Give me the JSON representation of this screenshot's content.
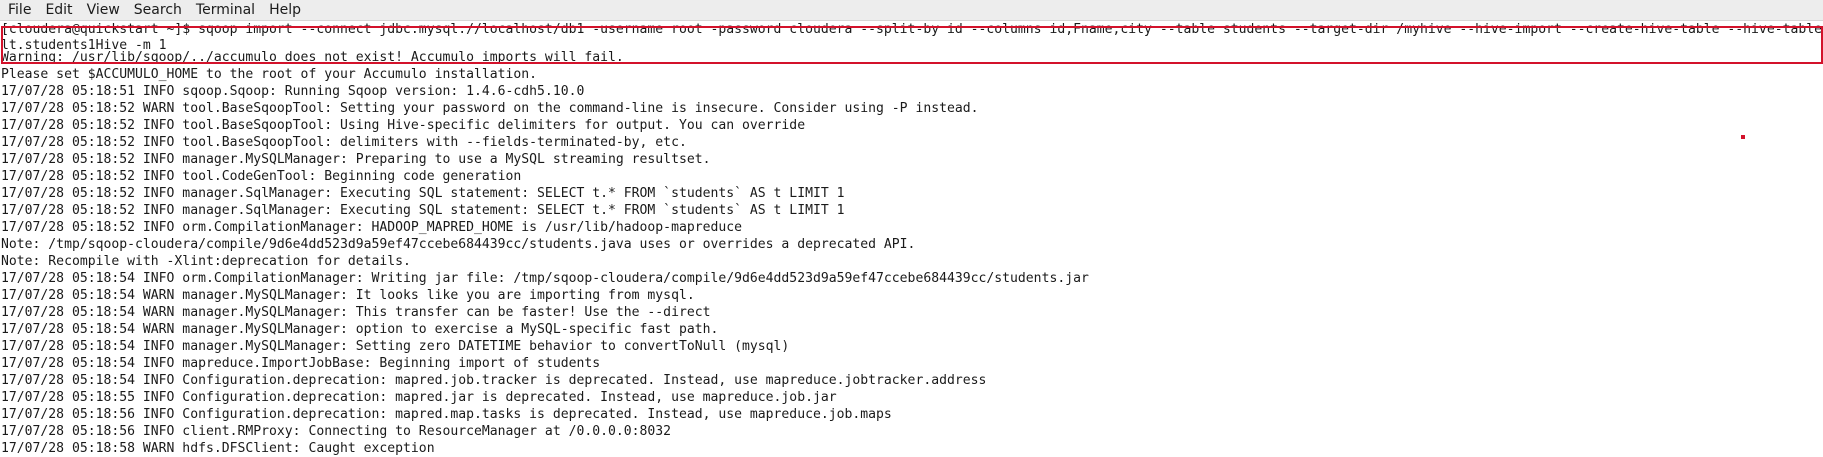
{
  "menu": [
    "File",
    "Edit",
    "View",
    "Search",
    "Terminal",
    "Help"
  ],
  "terminal": {
    "lines": [
      "[cloudera@quickstart ~]$ sqoop import --connect jdbc:mysql://localhost/db1 -username root -password cloudera --split-by id --columns id,Fname,city --table students --target-dir /myhive --hive-import --create-hive-table --hive-table",
      "lt.students1Hive -m 1",
      "Warning: /usr/lib/sqoop/../accumulo does not exist! Accumulo imports will fail.",
      "Please set $ACCUMULO_HOME to the root of your Accumulo installation.",
      "17/07/28 05:18:51 INFO sqoop.Sqoop: Running Sqoop version: 1.4.6-cdh5.10.0",
      "17/07/28 05:18:52 WARN tool.BaseSqoopTool: Setting your password on the command-line is insecure. Consider using -P instead.",
      "17/07/28 05:18:52 INFO tool.BaseSqoopTool: Using Hive-specific delimiters for output. You can override",
      "17/07/28 05:18:52 INFO tool.BaseSqoopTool: delimiters with --fields-terminated-by, etc.",
      "17/07/28 05:18:52 INFO manager.MySQLManager: Preparing to use a MySQL streaming resultset.",
      "17/07/28 05:18:52 INFO tool.CodeGenTool: Beginning code generation",
      "17/07/28 05:18:52 INFO manager.SqlManager: Executing SQL statement: SELECT t.* FROM `students` AS t LIMIT 1",
      "17/07/28 05:18:52 INFO manager.SqlManager: Executing SQL statement: SELECT t.* FROM `students` AS t LIMIT 1",
      "17/07/28 05:18:52 INFO orm.CompilationManager: HADOOP_MAPRED_HOME is /usr/lib/hadoop-mapreduce",
      "Note: /tmp/sqoop-cloudera/compile/9d6e4dd523d9a59ef47ccebe684439cc/students.java uses or overrides a deprecated API.",
      "Note: Recompile with -Xlint:deprecation for details.",
      "17/07/28 05:18:54 INFO orm.CompilationManager: Writing jar file: /tmp/sqoop-cloudera/compile/9d6e4dd523d9a59ef47ccebe684439cc/students.jar",
      "17/07/28 05:18:54 WARN manager.MySQLManager: It looks like you are importing from mysql.",
      "17/07/28 05:18:54 WARN manager.MySQLManager: This transfer can be faster! Use the --direct",
      "17/07/28 05:18:54 WARN manager.MySQLManager: option to exercise a MySQL-specific fast path.",
      "17/07/28 05:18:54 INFO manager.MySQLManager: Setting zero DATETIME behavior to convertToNull (mysql)",
      "17/07/28 05:18:54 INFO mapreduce.ImportJobBase: Beginning import of students",
      "17/07/28 05:18:54 INFO Configuration.deprecation: mapred.job.tracker is deprecated. Instead, use mapreduce.jobtracker.address",
      "17/07/28 05:18:55 INFO Configuration.deprecation: mapred.jar is deprecated. Instead, use mapreduce.job.jar",
      "17/07/28 05:18:56 INFO Configuration.deprecation: mapred.map.tasks is deprecated. Instead, use mapreduce.job.maps",
      "17/07/28 05:18:56 INFO client.RMProxy: Connecting to ResourceManager at /0.0.0.0:8032",
      "17/07/28 05:18:58 WARN hdfs.DFSClient: Caught exception"
    ]
  },
  "colors": {
    "highlight": "#d3122b",
    "text": "#1a1a1a",
    "background": "#ffffff",
    "menubar": "#ededed"
  }
}
